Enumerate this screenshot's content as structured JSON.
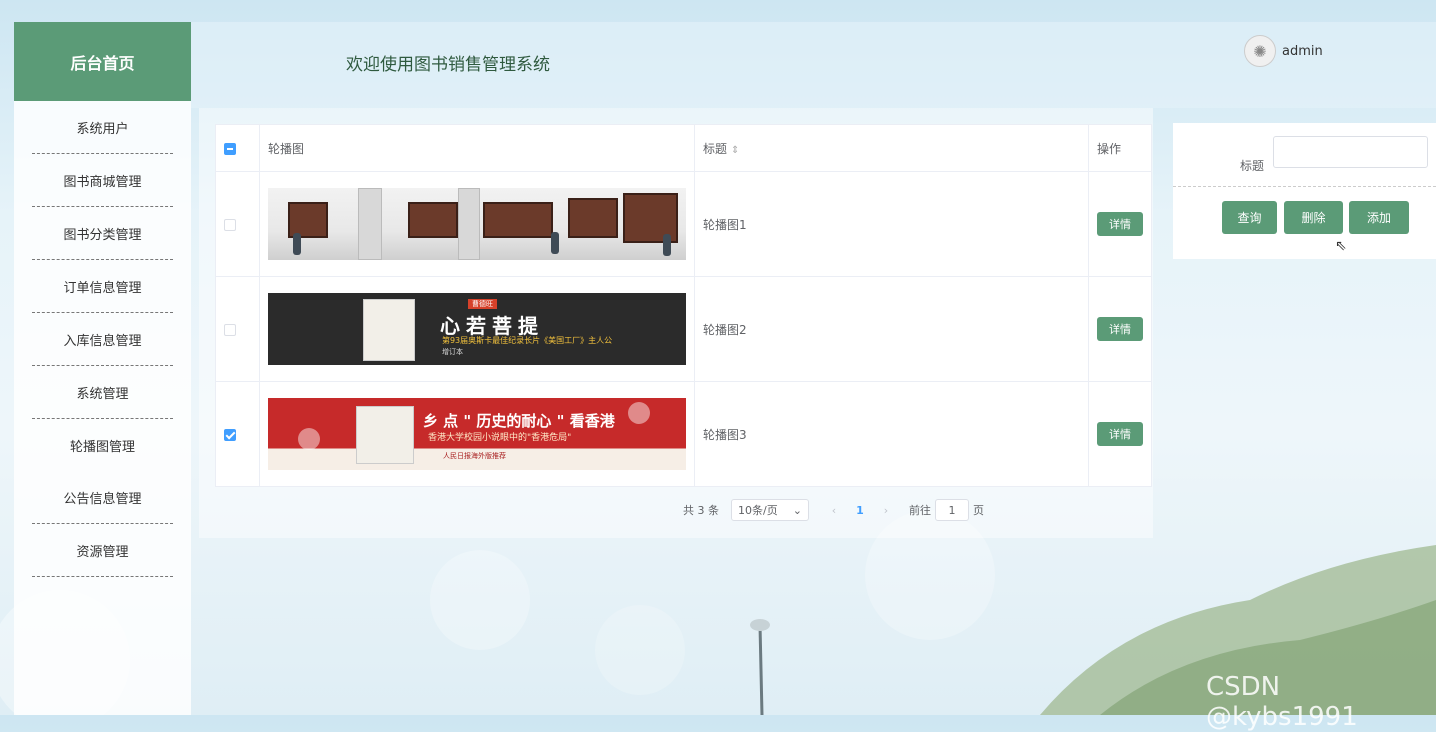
{
  "sidebar": {
    "title": "后台首页",
    "items": [
      {
        "label": "系统用户"
      },
      {
        "label": "图书商城管理"
      },
      {
        "label": "图书分类管理"
      },
      {
        "label": "订单信息管理"
      },
      {
        "label": "入库信息管理"
      },
      {
        "label": "系统管理"
      },
      {
        "label": "轮播图管理"
      },
      {
        "label": "公告信息管理"
      },
      {
        "label": "资源管理"
      }
    ]
  },
  "header": {
    "welcome": "欢迎使用图书销售管理系统",
    "username": "admin"
  },
  "table": {
    "columns": [
      "轮播图",
      "标题",
      "操作"
    ],
    "rows": [
      {
        "title": "轮播图1",
        "checked": false
      },
      {
        "title": "轮播图2",
        "checked": false
      },
      {
        "title": "轮播图3",
        "checked": true
      }
    ],
    "detail_label": "详情"
  },
  "banners": {
    "b2": {
      "badge": "曹德旺",
      "headline": "心若菩提",
      "tag": "第93届奥斯卡最佳纪录长片《美国工厂》主人公",
      "sub": "增订本"
    },
    "b3": {
      "headline": "乡 点 \" 历史的耐心 \" 看香港",
      "sub": "香港大学校园小说眼中的\"香港危局\"",
      "foot": "人民日报海外版推荐"
    }
  },
  "pager": {
    "total": "共 3 条",
    "page_size": "10条/页",
    "current": "1",
    "goto_prefix": "前往",
    "goto_value": "1",
    "goto_suffix": "页"
  },
  "search": {
    "label": "标题",
    "value": "",
    "query_label": "查询",
    "delete_label": "删除",
    "add_label": "添加"
  },
  "watermark": "CSDN @kybs1991",
  "colors": {
    "accent": "#5b9b77",
    "primary": "#409eff"
  }
}
